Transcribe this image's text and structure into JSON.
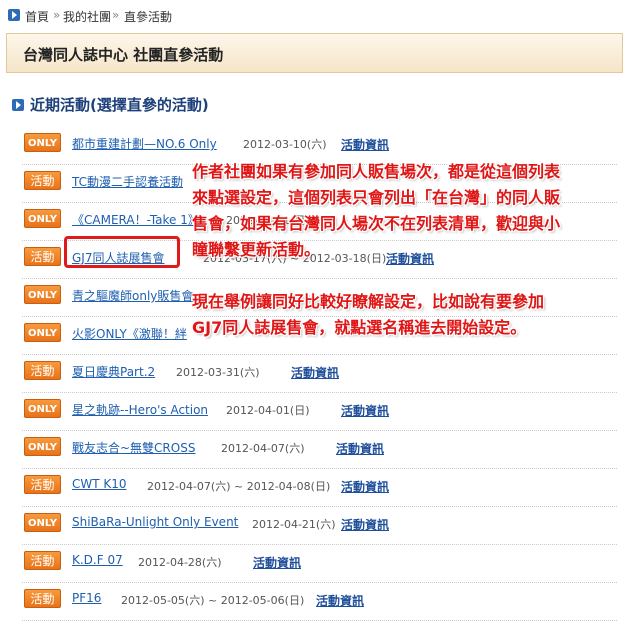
{
  "breadcrumb": {
    "items": [
      "首頁",
      "»",
      "我的社團",
      "»",
      "直參活動"
    ]
  },
  "page_title": "台灣同人誌中心 社團直參活動",
  "section_title": "近期活動(選擇直參的活動)",
  "info_link_label": "活動資訊",
  "events": [
    {
      "badge": "ONLY",
      "name": "都市重建計劃—NO.6 Only",
      "date": "2012-03-10(六)"
    },
    {
      "badge": "活動",
      "name": "TC動漫二手認養活動",
      "date": ""
    },
    {
      "badge": "ONLY",
      "name": "《CAMERA！-Take 1》",
      "date": "2012-03-11(日)"
    },
    {
      "badge": "活動",
      "name": "GJ7同人誌展售會",
      "date": "2012-03-17(六) ~ 2012-03-18(日)"
    },
    {
      "badge": "ONLY",
      "name": "青之驅魔師only販售會",
      "date": ""
    },
    {
      "badge": "ONLY",
      "name": "火影ONLY《激聯！絆",
      "date": ""
    },
    {
      "badge": "活動",
      "name": "夏日慶典Part.2",
      "date": "2012-03-31(六)"
    },
    {
      "badge": "ONLY",
      "name": "星之軌跡--Hero's Action",
      "date": "2012-04-01(日)"
    },
    {
      "badge": "ONLY",
      "name": "戰友志合~無雙CROSS",
      "date": "2012-04-07(六)"
    },
    {
      "badge": "活動",
      "name": "CWT K10",
      "date": "2012-04-07(六) ~ 2012-04-08(日)"
    },
    {
      "badge": "ONLY",
      "name": "ShiBaRa-Unlight Only Event",
      "date": "2012-04-21(六)"
    },
    {
      "badge": "活動",
      "name": "K.D.F 07",
      "date": "2012-04-28(六)"
    },
    {
      "badge": "活動",
      "name": "PF16",
      "date": "2012-05-05(六) ~ 2012-05-06(日)"
    }
  ],
  "annotation": {
    "paragraph1": [
      "作者社團如果有參加同人販售場次，都是從這個列表",
      "來點選設定，這個列表只會列出「在台灣」的同人販",
      "售會，如果有台灣同人場次不在列表清單，歡迎與小",
      "瞳聯繫更新活動。"
    ],
    "paragraph2": [
      "現在舉例讓同好比較好瞭解設定，比如說有要參加",
      "GJ7同人誌展售會，就點選名稱進去開始設定。"
    ],
    "color": "#e01616"
  },
  "colors": {
    "badge": "#f08a2c",
    "link": "#1f5fb0",
    "title_bg": "#f8ecd6",
    "highlight_box": "#e01a1a"
  }
}
